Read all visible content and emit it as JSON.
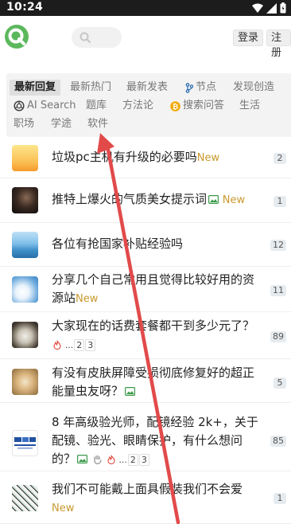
{
  "status_bar": {
    "time": "10:24"
  },
  "header": {
    "login_label": "登录",
    "register_label": "注册"
  },
  "nav": {
    "items": [
      {
        "label": "最新回复",
        "active": true
      },
      {
        "label": "最新热门"
      },
      {
        "label": "最新发表"
      },
      {
        "label": "节点",
        "icon": "branch-icon"
      },
      {
        "label": "发现创造"
      },
      {
        "label": "AI Search",
        "icon": "openai-icon"
      },
      {
        "label": "题库"
      },
      {
        "label": "方法论"
      },
      {
        "label": "搜索问答",
        "icon": "bitcoin-icon"
      },
      {
        "label": "生活"
      },
      {
        "label": "职场"
      },
      {
        "label": "学途"
      },
      {
        "label": "软件"
      }
    ]
  },
  "topics": [
    {
      "title": "垃圾pc主机有升级的必要吗",
      "new": "New",
      "replies": "2",
      "avatar": "peach"
    },
    {
      "title": "推特上爆火的气质美女提示词",
      "new": "New",
      "image_icon": true,
      "replies": "1",
      "avatar": "dark"
    },
    {
      "title": "各位有抢国家补贴经验吗",
      "replies": "12",
      "avatar": "sea"
    },
    {
      "title": "分享几个自己常用且觉得比较好用的资源站",
      "new": "New",
      "replies": "11",
      "avatar": "sky"
    },
    {
      "title": "大家现在的话费套餐都干到多少元了？",
      "hot_icon": true,
      "pages": [
        "...",
        "2",
        "3"
      ],
      "replies": "89",
      "avatar": "dog"
    },
    {
      "title": "有没有皮肤屏障受损彻底修复好的超正能量虫友呀？",
      "image_icon": true,
      "replies": "5",
      "avatar": "cat"
    },
    {
      "title": "8 年高级验光师，配镜经验 2k+，关于配镜、验光、眼睛保护，有什么想问的？",
      "image_icon": true,
      "hand_icon": true,
      "hot_icon": true,
      "pages": [
        "...",
        "2",
        "3"
      ],
      "replies": "85",
      "avatar": "logo"
    },
    {
      "title": "我们不可能戴上面具假装我们不会爱",
      "new": "New",
      "replies": "1",
      "avatar": "comic"
    }
  ]
}
